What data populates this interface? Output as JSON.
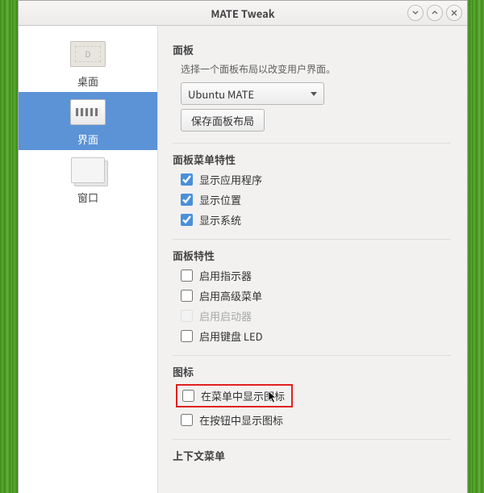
{
  "window": {
    "title": "MATE Tweak"
  },
  "sidebar": {
    "items": [
      {
        "label": "桌面"
      },
      {
        "label": "界面"
      },
      {
        "label": "窗口"
      }
    ]
  },
  "panel": {
    "heading": "面板",
    "hint": "选择一个面板布局以改变用户界面。",
    "layout_selected": "Ubuntu MATE",
    "save_btn": "保存面板布局"
  },
  "panel_menu": {
    "heading": "面板菜单特性",
    "items": [
      {
        "label": "显示应用程序",
        "checked": true
      },
      {
        "label": "显示位置",
        "checked": true
      },
      {
        "label": "显示系统",
        "checked": true
      }
    ]
  },
  "panel_features": {
    "heading": "面板特性",
    "items": [
      {
        "label": "启用指示器",
        "checked": false,
        "disabled": false
      },
      {
        "label": "启用高级菜单",
        "checked": false,
        "disabled": false
      },
      {
        "label": "启用启动器",
        "checked": false,
        "disabled": true
      },
      {
        "label": "启用键盘 LED",
        "checked": false,
        "disabled": false
      }
    ]
  },
  "icons": {
    "heading": "图标",
    "items": [
      {
        "label": "在菜单中显示图标",
        "checked": false,
        "highlighted": true
      },
      {
        "label": "在按钮中显示图标",
        "checked": false,
        "highlighted": false
      }
    ]
  },
  "context": {
    "heading": "上下文菜单"
  }
}
